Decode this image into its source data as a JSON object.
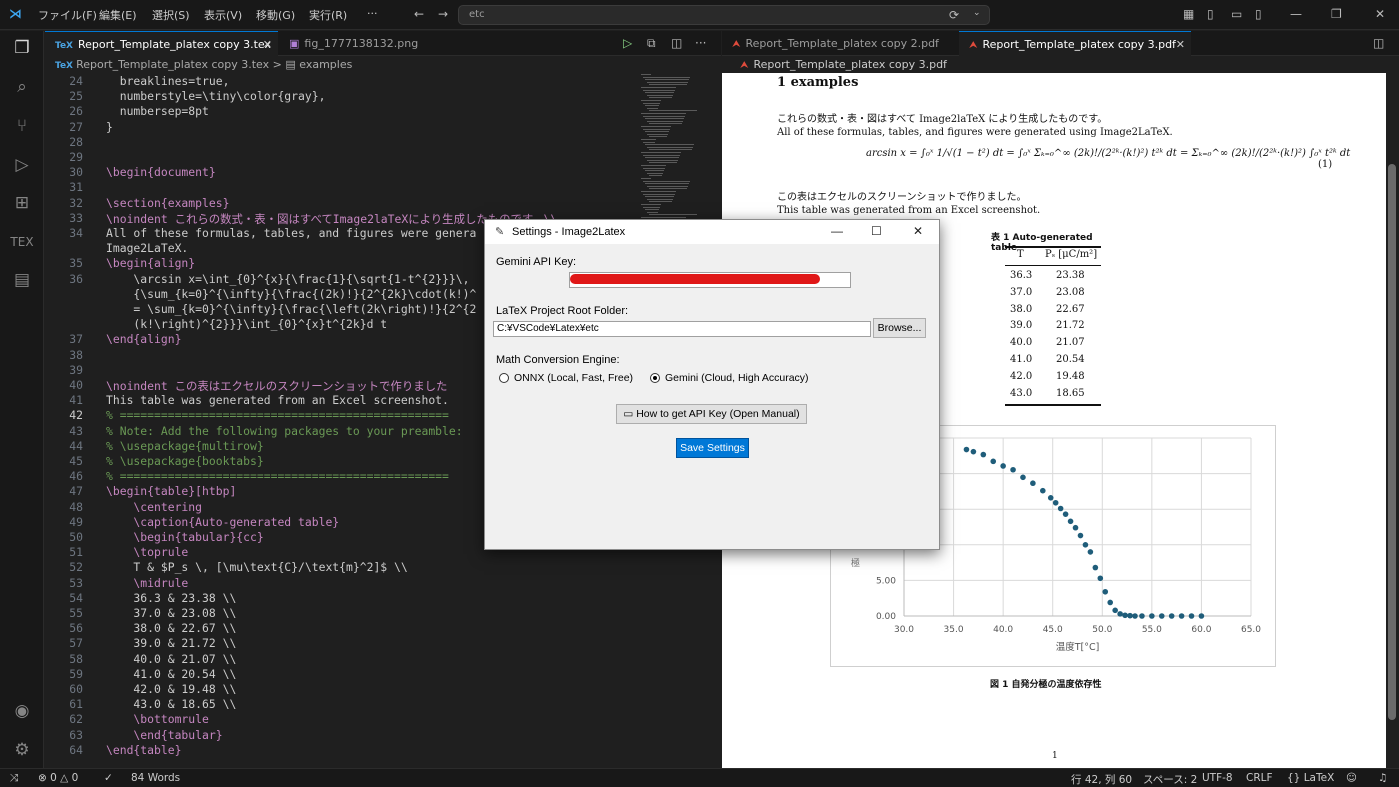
{
  "menu": [
    "ファイル(F)",
    "編集(E)",
    "選択(S)",
    "表示(V)",
    "移動(G)",
    "実行(R)",
    "···"
  ],
  "command_center": {
    "text": "etc"
  },
  "editor": {
    "tabs": [
      {
        "label": "Report_Template_platex copy 3.tex",
        "active": true
      },
      {
        "label": "fig_1777138132.png",
        "active": false
      }
    ],
    "breadcrumb": {
      "file": "Report_Template_platex copy 3.tex",
      "sep": ">",
      "section": "examples"
    },
    "current_line": 42,
    "lines": [
      {
        "n": "24",
        "t": "  breaklines=true,"
      },
      {
        "n": "25",
        "t": "  numberstyle=\\tiny\\color{gray},"
      },
      {
        "n": "26",
        "t": "  numbersep=8pt"
      },
      {
        "n": "27",
        "t": "}"
      },
      {
        "n": "28",
        "t": ""
      },
      {
        "n": "29",
        "t": ""
      },
      {
        "n": "30",
        "t": "\\begin{document}"
      },
      {
        "n": "31",
        "t": ""
      },
      {
        "n": "32",
        "t": "\\section{examples}"
      },
      {
        "n": "33",
        "t": "\\noindent これらの数式・表・図はすべてImage2laTeXにより生成したものです。\\\\"
      },
      {
        "n": "34",
        "t": "All of these formulas, tables, and figures were genera"
      },
      {
        "n": "",
        "t": "Image2LaTeX."
      },
      {
        "n": "35",
        "t": "\\begin{align}"
      },
      {
        "n": "36",
        "t": "    \\arcsin x=\\int_{0}^{x}{\\frac{1}{\\sqrt{1-t^{2}}}\\,"
      },
      {
        "n": "",
        "t": "    {\\sum_{k=0}^{\\infty}{\\frac{(2k)!}{2^{2k}\\cdot(k!)^"
      },
      {
        "n": "",
        "t": "    = \\sum_{k=0}^{\\infty}{\\frac{\\left(2k\\right)!}{2^{2"
      },
      {
        "n": "",
        "t": "    (k!\\right)^{2}}}\\int_{0}^{x}t^{2k}d t"
      },
      {
        "n": "37",
        "t": "\\end{align}"
      },
      {
        "n": "38",
        "t": ""
      },
      {
        "n": "39",
        "t": ""
      },
      {
        "n": "40",
        "t": "\\noindent この表はエクセルのスクリーンショットで作りました"
      },
      {
        "n": "41",
        "t": "This table was generated from an Excel screenshot."
      },
      {
        "n": "42",
        "t": "% ================================================"
      },
      {
        "n": "43",
        "t": "% Note: Add the following packages to your preamble:"
      },
      {
        "n": "44",
        "t": "% \\usepackage{multirow}"
      },
      {
        "n": "45",
        "t": "% \\usepackage{booktabs}"
      },
      {
        "n": "46",
        "t": "% ================================================"
      },
      {
        "n": "47",
        "t": "\\begin{table}[htbp]"
      },
      {
        "n": "48",
        "t": "    \\centering"
      },
      {
        "n": "49",
        "t": "    \\caption{Auto-generated table}"
      },
      {
        "n": "50",
        "t": "    \\begin{tabular}{cc}"
      },
      {
        "n": "51",
        "t": "    \\toprule"
      },
      {
        "n": "52",
        "t": "    T & $P_s \\, [\\mu\\text{C}/\\text{m}^2]$ \\\\"
      },
      {
        "n": "53",
        "t": "    \\midrule"
      },
      {
        "n": "54",
        "t": "    36.3 & 23.38 \\\\"
      },
      {
        "n": "55",
        "t": "    37.0 & 23.08 \\\\"
      },
      {
        "n": "56",
        "t": "    38.0 & 22.67 \\\\"
      },
      {
        "n": "57",
        "t": "    39.0 & 21.72 \\\\"
      },
      {
        "n": "58",
        "t": "    40.0 & 21.07 \\\\"
      },
      {
        "n": "59",
        "t": "    41.0 & 20.54 \\\\"
      },
      {
        "n": "60",
        "t": "    42.0 & 19.48 \\\\"
      },
      {
        "n": "61",
        "t": "    43.0 & 18.65 \\\\"
      },
      {
        "n": "62",
        "t": "    \\bottomrule"
      },
      {
        "n": "63",
        "t": "    \\end{tabular}"
      },
      {
        "n": "64",
        "t": "\\end{table}"
      }
    ]
  },
  "pdf": {
    "tabs": [
      {
        "label": "Report_Template_platex copy 2.pdf",
        "active": false
      },
      {
        "label": "Report_Template_platex copy 3.pdf",
        "active": true
      }
    ],
    "breadcrumb": "Report_Template_platex copy 3.pdf",
    "section": "1   examples",
    "para_jp": "これらの数式・表・図はすべて Image2laTeX により生成したものです。",
    "para_en": "All of these formulas, tables, and figures were generated using Image2LaTeX.",
    "formula": "arcsin x = ∫₀ˣ 1/√(1 − t²) dt = ∫₀ˣ Σₖ₌₀^∞ (2k)!/(2²ᵏ·(k!)²) t²ᵏ dt = Σₖ₌₀^∞ (2k)!/(2²ᵏ·(k!)²) ∫₀ˣ t²ᵏ dt",
    "eq_no": "(1)",
    "table_intro_jp": "この表はエクセルのスクリーンショットで作りました。",
    "table_intro_en": "This table was generated from an Excel screenshot.",
    "table": {
      "caption": "表 1   Auto-generated table",
      "headers": [
        "T",
        "Pₛ [μC/m²]"
      ],
      "rows": [
        [
          "36.3",
          "23.38"
        ],
        [
          "37.0",
          "23.08"
        ],
        [
          "38.0",
          "22.67"
        ],
        [
          "39.0",
          "21.72"
        ],
        [
          "40.0",
          "21.07"
        ],
        [
          "41.0",
          "20.54"
        ],
        [
          "42.0",
          "19.48"
        ],
        [
          "43.0",
          "18.65"
        ]
      ]
    },
    "figure_caption": "図 1   自発分極の温度依存性",
    "page_number": "1"
  },
  "chart_data": {
    "type": "scatter",
    "xlabel": "温度T[°C]",
    "ylabel": "",
    "y_tick_fragment": "極",
    "xlim": [
      30,
      65
    ],
    "ylim": [
      0,
      25
    ],
    "x_ticks": [
      "30.0",
      "35.0",
      "40.0",
      "45.0",
      "50.0",
      "55.0",
      "60.0",
      "65.0"
    ],
    "y_ticks": [
      {
        "value": 0,
        "label": "0.00"
      },
      {
        "value": 5,
        "label": "5.00"
      }
    ],
    "grid": true,
    "color": "#1f5d7a",
    "points": [
      [
        36.3,
        23.38
      ],
      [
        37.0,
        23.08
      ],
      [
        38.0,
        22.67
      ],
      [
        39.0,
        21.72
      ],
      [
        40.0,
        21.07
      ],
      [
        41.0,
        20.54
      ],
      [
        42.0,
        19.48
      ],
      [
        43.0,
        18.65
      ],
      [
        44.0,
        17.6
      ],
      [
        44.8,
        16.6
      ],
      [
        45.3,
        15.9
      ],
      [
        45.8,
        15.1
      ],
      [
        46.3,
        14.3
      ],
      [
        46.8,
        13.3
      ],
      [
        47.3,
        12.4
      ],
      [
        47.8,
        11.3
      ],
      [
        48.3,
        10.0
      ],
      [
        48.8,
        9.0
      ],
      [
        49.3,
        6.8
      ],
      [
        49.8,
        5.3
      ],
      [
        50.3,
        3.4
      ],
      [
        50.8,
        1.9
      ],
      [
        51.3,
        0.8
      ],
      [
        51.8,
        0.3
      ],
      [
        52.3,
        0.1
      ],
      [
        52.8,
        0.05
      ],
      [
        53.3,
        0
      ],
      [
        54.0,
        0
      ],
      [
        55.0,
        0
      ],
      [
        56.0,
        0
      ],
      [
        57.0,
        0
      ],
      [
        58.0,
        0
      ],
      [
        59.0,
        0
      ],
      [
        60.0,
        0
      ]
    ]
  },
  "dialog": {
    "title": "Settings - Image2Latex",
    "api_key_label": "Gemini API Key:",
    "root_label": "LaTeX Project Root Folder:",
    "root_value": "C:¥VSCode¥Latex¥etc",
    "browse": "Browse...",
    "engine_label": "Math Conversion Engine:",
    "engine_options": [
      "ONNX (Local, Fast, Free)",
      "Gemini (Cloud, High Accuracy)"
    ],
    "engine_selected": 1,
    "help_button": "How to get API Key (Open Manual)",
    "save_button": "Save Settings",
    "redact_color": "#e01818"
  },
  "status": {
    "problems": "0",
    "warnings": "0",
    "words": "84 Words",
    "position": "行 42, 列 60",
    "spaces": "スペース: 2",
    "encoding": "UTF-8",
    "eol": "CRLF",
    "language": "LaTeX"
  },
  "colors": {
    "accent": "#0078d4",
    "save": "#0078d7"
  }
}
